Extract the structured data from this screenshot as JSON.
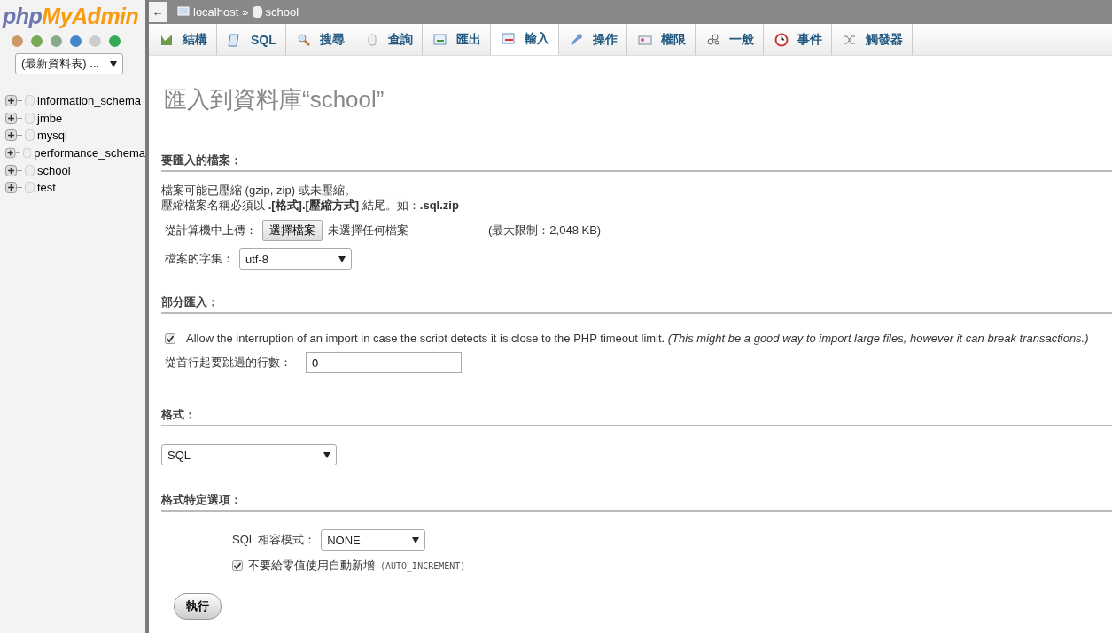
{
  "sidebar": {
    "logo": {
      "part_1": "php",
      "part_2": "MyAdmin"
    },
    "recent_select": {
      "value": "(最新資料表) ..."
    },
    "databases": [
      {
        "name": "information_schema",
        "expanded": false
      },
      {
        "name": "jmbe",
        "expanded": false
      },
      {
        "name": "mysql",
        "expanded": false
      },
      {
        "name": "performance_schema",
        "expanded": false
      },
      {
        "name": "school",
        "expanded": false
      },
      {
        "name": "test",
        "expanded": false
      }
    ]
  },
  "breadcrumb": {
    "back": "←",
    "server": "localhost",
    "separator": "»",
    "database": "school"
  },
  "tabs": [
    {
      "label": "結構",
      "kind": "structure",
      "selected": false
    },
    {
      "label": "SQL",
      "kind": "sql",
      "selected": false
    },
    {
      "label": "搜尋",
      "kind": "search",
      "selected": false
    },
    {
      "label": "查詢",
      "kind": "query",
      "selected": false
    },
    {
      "label": "匯出",
      "kind": "export",
      "selected": false
    },
    {
      "label": "輸入",
      "kind": "import",
      "selected": true
    },
    {
      "label": "操作",
      "kind": "wrench",
      "selected": false
    },
    {
      "label": "權限",
      "kind": "privileges",
      "selected": false
    },
    {
      "label": "一般",
      "kind": "routines",
      "selected": false
    },
    {
      "label": "事件",
      "kind": "clock",
      "selected": false
    },
    {
      "label": "觸發器",
      "kind": "triggers",
      "selected": false
    }
  ],
  "page_title": "匯入到資料庫“school”",
  "file_section": {
    "heading": "要匯入的檔案：",
    "note_1": "檔案可能已壓縮 (gzip, zip) 或未壓縮。",
    "note_2": "壓縮檔案名稱必須以 **.[格式].[壓縮方式]** 結尾。如：**.sql.zip**",
    "upload_label": "從計算機中上傳：",
    "choose_button": "選擇檔案",
    "no_file": "未選擇任何檔案",
    "max_size": "(最大限制：2,048 KB)",
    "charset_label": "檔案的字集：",
    "charset_value": "utf-8"
  },
  "partial_section": {
    "heading": "部分匯入：",
    "allow_interrupt": {
      "checked": true,
      "text": "Allow the interruption of an import in case the script detects it is close to the PHP timeout limit. *(This might be a good way to import large files, however it can break transactions.)*"
    },
    "skip_label": "從首行起要跳過的行數：",
    "skip_value": "0"
  },
  "format_section": {
    "heading": "格式：",
    "format_value": "SQL"
  },
  "options_section": {
    "heading": "格式特定選項：",
    "compat_label": "SQL 相容模式：",
    "compat_value": "NONE",
    "no_auto_value": {
      "checked": true,
      "text": "不要給零值使用自動新增",
      "code": "(AUTO_INCREMENT)"
    }
  },
  "go_button": "執行"
}
